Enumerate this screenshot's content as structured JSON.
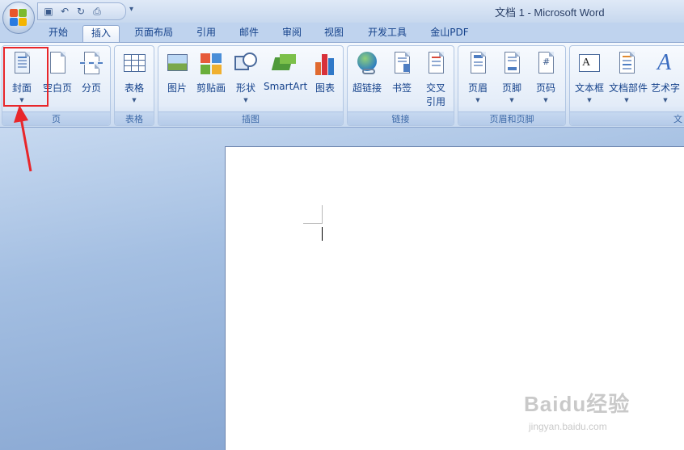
{
  "window": {
    "title": "文档 1 - Microsoft Word"
  },
  "tabs": [
    {
      "label": "开始"
    },
    {
      "label": "插入",
      "active": true
    },
    {
      "label": "页面布局"
    },
    {
      "label": "引用"
    },
    {
      "label": "邮件"
    },
    {
      "label": "审阅"
    },
    {
      "label": "视图"
    },
    {
      "label": "开发工具"
    },
    {
      "label": "金山PDF"
    }
  ],
  "ribbon": {
    "groups": {
      "pages": {
        "label": "页",
        "buttons": {
          "cover": "封面",
          "blank": "空白页",
          "break": "分页"
        }
      },
      "tables": {
        "label": "表格",
        "buttons": {
          "table": "表格"
        }
      },
      "illustrations": {
        "label": "插图",
        "buttons": {
          "picture": "图片",
          "clipart": "剪贴画",
          "shapes": "形状",
          "smartart": "SmartArt",
          "chart": "图表"
        }
      },
      "links": {
        "label": "链接",
        "buttons": {
          "hyperlink": "超链接",
          "bookmark": "书签",
          "xref1": "交叉",
          "xref2": "引用"
        }
      },
      "header_footer": {
        "label": "页眉和页脚",
        "buttons": {
          "header": "页眉",
          "footer": "页脚",
          "page_number": "页码"
        }
      },
      "text": {
        "label": "文",
        "buttons": {
          "textbox": "文本框",
          "quickparts": "文档部件",
          "wordart": "艺术字"
        }
      }
    }
  },
  "watermark": {
    "brand": "Baidu经验",
    "url": "jingyan.baidu.com"
  },
  "colors": {
    "highlight": "#e8262a",
    "ribbon_text": "#15428b"
  }
}
